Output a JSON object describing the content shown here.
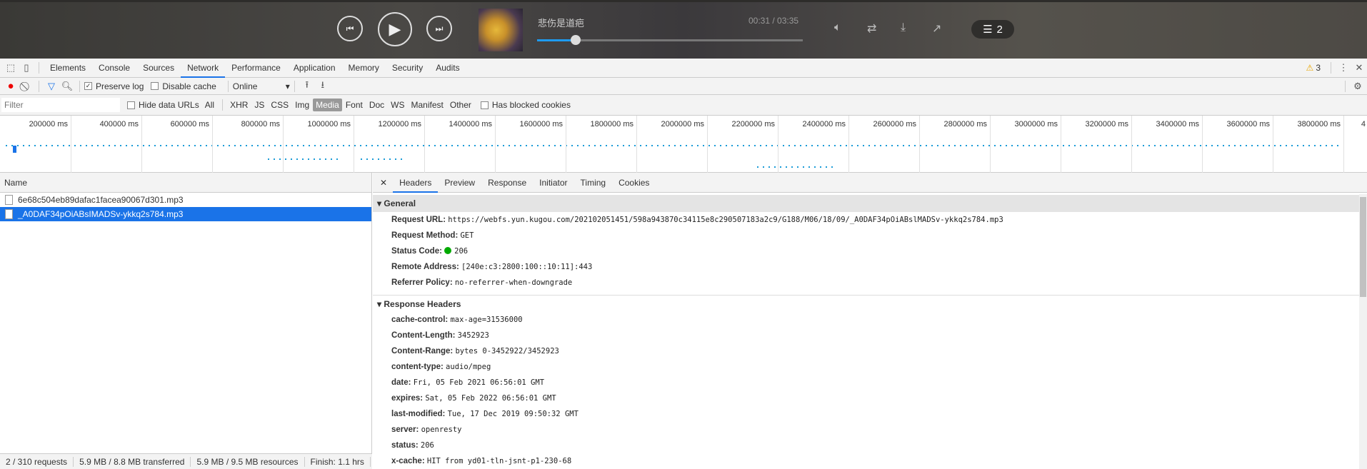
{
  "player": {
    "song_title": "悲伤是道疤",
    "time": "00:31 / 03:35",
    "progress_fraction": 0.145,
    "playlist_count": "2",
    "accent": "#1e9bf0"
  },
  "devtools": {
    "tabs": [
      "Elements",
      "Console",
      "Sources",
      "Network",
      "Performance",
      "Application",
      "Memory",
      "Security",
      "Audits"
    ],
    "active_tab": "Network",
    "warnings": "3",
    "toolbar": {
      "preserve_log": "Preserve log",
      "preserve_log_checked": true,
      "disable_cache": "Disable cache",
      "throttle": "Online"
    },
    "filter": {
      "placeholder": "Filter",
      "hide_data_urls": "Hide data URLs",
      "types": [
        "All",
        "XHR",
        "JS",
        "CSS",
        "Img",
        "Media",
        "Font",
        "Doc",
        "WS",
        "Manifest",
        "Other"
      ],
      "active_type": "Media",
      "has_blocked": "Has blocked cookies"
    },
    "timeline_ticks": [
      "200000 ms",
      "400000 ms",
      "600000 ms",
      "800000 ms",
      "1000000 ms",
      "1200000 ms",
      "1400000 ms",
      "1600000 ms",
      "1800000 ms",
      "2000000 ms",
      "2200000 ms",
      "2400000 ms",
      "2600000 ms",
      "2800000 ms",
      "3000000 ms",
      "3200000 ms",
      "3400000 ms",
      "3600000 ms",
      "3800000 ms",
      "4"
    ],
    "list": {
      "header": "Name",
      "requests": [
        "6e68c504eb89dafac1facea90067d301.mp3",
        "_A0DAF34pOiABsIMADSv-ykkq2s784.mp3"
      ],
      "selected": 1
    },
    "status": [
      "2 / 310 requests",
      "5.9 MB / 8.8 MB transferred",
      "5.9 MB / 9.5 MB resources",
      "Finish: 1.1 hrs"
    ],
    "detail_tabs": [
      "Headers",
      "Preview",
      "Response",
      "Initiator",
      "Timing",
      "Cookies"
    ],
    "general": {
      "title": "General",
      "rows": [
        {
          "k": "Request URL:",
          "v": "https://webfs.yun.kugou.com/202102051451/598a943870c34115e8c290507183a2c9/G188/M06/18/09/_A0DAF34pOiABslMADSv-ykkq2s784.mp3"
        },
        {
          "k": "Request Method:",
          "v": "GET"
        },
        {
          "k": "Status Code:",
          "v": "206"
        },
        {
          "k": "Remote Address:",
          "v": "[240e:c3:2800:100::10:11]:443"
        },
        {
          "k": "Referrer Policy:",
          "v": "no-referrer-when-downgrade"
        }
      ]
    },
    "response": {
      "title": "Response Headers",
      "rows": [
        {
          "k": "cache-control:",
          "v": "max-age=31536000"
        },
        {
          "k": "Content-Length:",
          "v": "3452923"
        },
        {
          "k": "Content-Range:",
          "v": "bytes 0-3452922/3452923"
        },
        {
          "k": "content-type:",
          "v": "audio/mpeg"
        },
        {
          "k": "date:",
          "v": "Fri, 05 Feb 2021 06:56:01 GMT"
        },
        {
          "k": "expires:",
          "v": "Sat, 05 Feb 2022 06:56:01 GMT"
        },
        {
          "k": "last-modified:",
          "v": "Tue, 17 Dec 2019 09:50:32 GMT"
        },
        {
          "k": "server:",
          "v": "openresty"
        },
        {
          "k": "status:",
          "v": "206"
        },
        {
          "k": "x-cache:",
          "v": "HIT from yd01-tln-jsnt-p1-230-68"
        }
      ]
    }
  }
}
